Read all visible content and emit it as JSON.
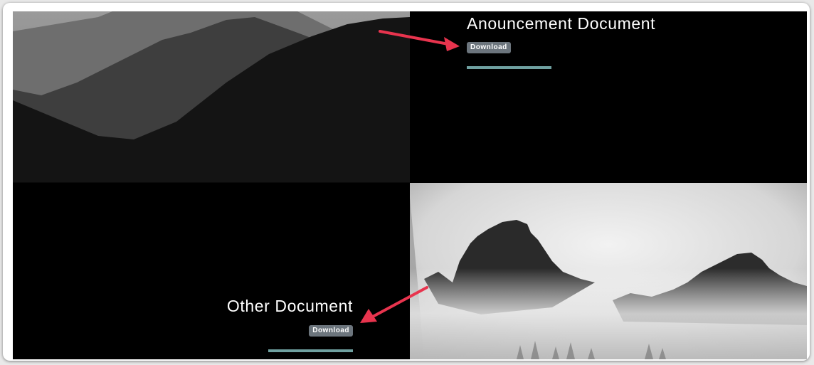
{
  "documents": [
    {
      "title": "Anouncement Document",
      "button_label": "Download"
    },
    {
      "title": "Other Document",
      "button_label": "Download"
    }
  ],
  "images": [
    {
      "name": "mountain-ridges-image",
      "tone": "grayscale"
    },
    {
      "name": "misty-peaks-image",
      "tone": "grayscale"
    }
  ],
  "colors": {
    "accent_rule": "#6fa0a0",
    "button_bg": "#6c757d",
    "annotation_arrow": "#e8344e",
    "tile_bg": "#000000"
  }
}
